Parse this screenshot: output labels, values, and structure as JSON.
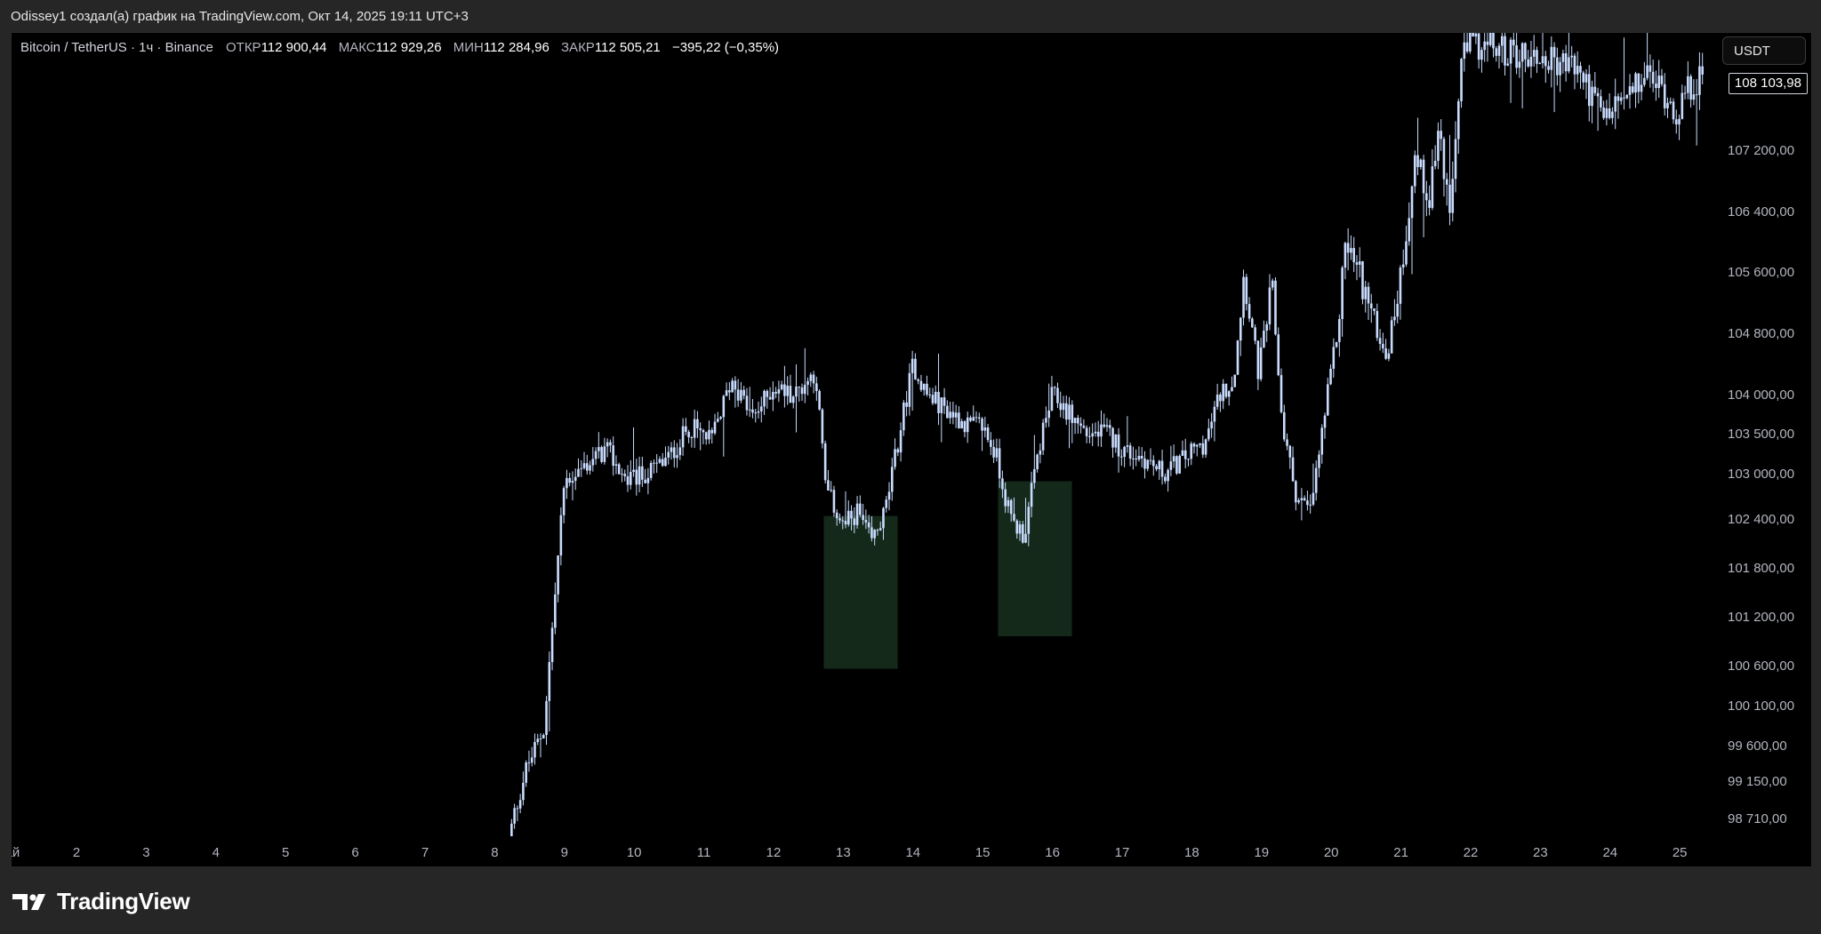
{
  "header": {
    "credit": "Odissey1 создал(а) график на TradingView.com, Окт 14, 2025 19:11 UTC+3"
  },
  "legend": {
    "symbol": "Bitcoin / TetherUS · 1ч · Binance",
    "open_label": "ОТКР",
    "open": "112 900,44",
    "high_label": "МАКС",
    "high": "112 929,26",
    "low_label": "МИН",
    "low": "112 284,96",
    "close_label": "ЗАКР",
    "close": "112 505,21",
    "change": "−395,22 (−0,35%)"
  },
  "currency": "USDT",
  "last_price_tag": "108 103,98",
  "brand": "TradingView",
  "colors": {
    "background": "#000000",
    "candle": "#c9dcff",
    "zone_fill": "#14291a",
    "axis_text": "#b2b5be"
  },
  "chart_data": {
    "type": "candlestick",
    "symbol": "Bitcoin / TetherUS",
    "interval": "1ч",
    "price_axis": [
      {
        "value": 98710,
        "label": "98 710,00"
      },
      {
        "value": 99150,
        "label": "99 150,00"
      },
      {
        "value": 99600,
        "label": "99 600,00"
      },
      {
        "value": 100100,
        "label": "100 100,00"
      },
      {
        "value": 100600,
        "label": "100 600,00"
      },
      {
        "value": 101200,
        "label": "101 200,00"
      },
      {
        "value": 101800,
        "label": "101 800,00"
      },
      {
        "value": 102400,
        "label": "102 400,00"
      },
      {
        "value": 103000,
        "label": "103 000,00"
      },
      {
        "value": 103500,
        "label": "103 500,00"
      },
      {
        "value": 104000,
        "label": "104 000,00"
      },
      {
        "value": 104800,
        "label": "104 800,00"
      },
      {
        "value": 105600,
        "label": "105 600,00"
      },
      {
        "value": 106400,
        "label": "106 400,00"
      },
      {
        "value": 107200,
        "label": "107 200,00"
      }
    ],
    "x_ticks": [
      "Май",
      "2",
      "3",
      "4",
      "5",
      "6",
      "7",
      "8",
      "9",
      "10",
      "11",
      "12",
      "13",
      "14",
      "15",
      "16",
      "17",
      "18",
      "19",
      "20",
      "21",
      "22",
      "23",
      "24",
      "25"
    ],
    "x_range_days": [
      0.8,
      25.2
    ],
    "first_bar_day": 8.2,
    "ylim": [
      98400,
      108200
    ],
    "price_path": [
      [
        8.2,
        98500
      ],
      [
        8.45,
        99300
      ],
      [
        8.7,
        99800
      ],
      [
        8.85,
        101300
      ],
      [
        9.0,
        102900
      ],
      [
        9.3,
        103100
      ],
      [
        9.6,
        103300
      ],
      [
        9.9,
        102900
      ],
      [
        10.2,
        103000
      ],
      [
        10.5,
        103200
      ],
      [
        10.8,
        103600
      ],
      [
        11.1,
        103400
      ],
      [
        11.4,
        104200
      ],
      [
        11.7,
        103700
      ],
      [
        12.0,
        104100
      ],
      [
        12.3,
        104000
      ],
      [
        12.6,
        104300
      ],
      [
        12.75,
        102800
      ],
      [
        13.0,
        102300
      ],
      [
        13.2,
        102500
      ],
      [
        13.4,
        102100
      ],
      [
        13.6,
        102500
      ],
      [
        13.85,
        103700
      ],
      [
        14.0,
        104400
      ],
      [
        14.2,
        104000
      ],
      [
        14.5,
        103800
      ],
      [
        14.8,
        103600
      ],
      [
        15.0,
        103600
      ],
      [
        15.2,
        103200
      ],
      [
        15.4,
        102400
      ],
      [
        15.6,
        102200
      ],
      [
        15.8,
        103300
      ],
      [
        16.0,
        104000
      ],
      [
        16.2,
        103800
      ],
      [
        16.5,
        103500
      ],
      [
        16.8,
        103500
      ],
      [
        17.0,
        103300
      ],
      [
        17.3,
        103200
      ],
      [
        17.6,
        103000
      ],
      [
        17.9,
        103200
      ],
      [
        18.2,
        103400
      ],
      [
        18.4,
        104000
      ],
      [
        18.6,
        104200
      ],
      [
        18.75,
        105600
      ],
      [
        18.95,
        104300
      ],
      [
        19.05,
        104800
      ],
      [
        19.15,
        105400
      ],
      [
        19.3,
        103600
      ],
      [
        19.5,
        102700
      ],
      [
        19.7,
        102500
      ],
      [
        19.9,
        103700
      ],
      [
        20.1,
        104900
      ],
      [
        20.2,
        106000
      ],
      [
        20.4,
        105600
      ],
      [
        20.6,
        105000
      ],
      [
        20.8,
        104500
      ],
      [
        21.0,
        105600
      ],
      [
        21.2,
        107100
      ],
      [
        21.4,
        106600
      ],
      [
        21.55,
        107500
      ],
      [
        21.7,
        106200
      ],
      [
        21.85,
        108300
      ],
      [
        22.0,
        108600
      ],
      [
        23.5,
        108300
      ],
      [
        23.75,
        107900
      ],
      [
        23.9,
        107600
      ],
      [
        24.1,
        107800
      ],
      [
        24.3,
        107900
      ],
      [
        24.5,
        108200
      ],
      [
        24.75,
        108000
      ],
      [
        24.95,
        107700
      ],
      [
        25.2,
        108100
      ]
    ],
    "highlight_zones": [
      {
        "from_day": 12.72,
        "to_day": 13.78,
        "top": 102440,
        "bottom": 100560
      },
      {
        "from_day": 15.22,
        "to_day": 16.28,
        "top": 102900,
        "bottom": 100960
      }
    ],
    "last_price": 108103.98
  }
}
